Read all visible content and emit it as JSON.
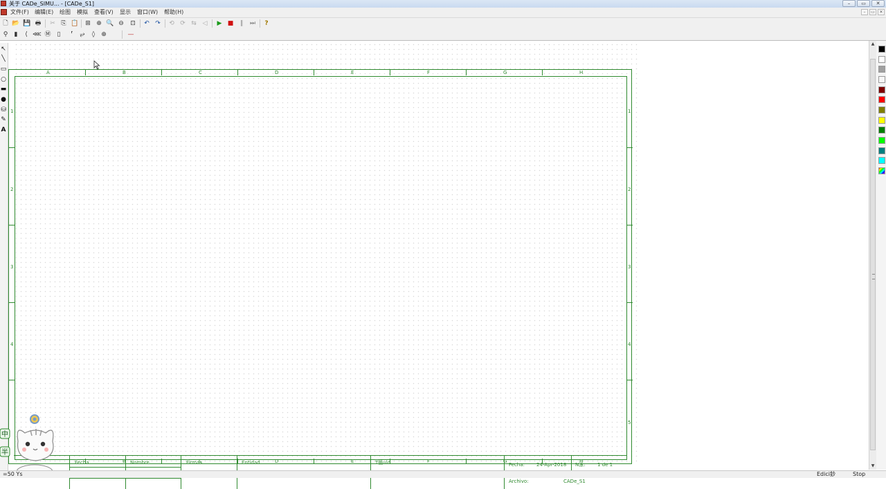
{
  "window": {
    "title": "关于 CADe_SIMU... - [CADe_S1]",
    "controls": [
      "–",
      "▭",
      "✕"
    ]
  },
  "mdi_controls": [
    "–",
    "▭",
    "✕"
  ],
  "menu": [
    {
      "id": "file",
      "label": "文件(F)"
    },
    {
      "id": "edit",
      "label": "编辑(E)"
    },
    {
      "id": "draw",
      "label": "绘图"
    },
    {
      "id": "simulate",
      "label": "模拟"
    },
    {
      "id": "view",
      "label": "查看(V)"
    },
    {
      "id": "display",
      "label": "显示"
    },
    {
      "id": "window",
      "label": "窗口(W)"
    },
    {
      "id": "help",
      "label": "帮助(H)"
    }
  ],
  "toolbar1": [
    {
      "id": "new",
      "glyph": "🗋",
      "icon": "new-file-icon"
    },
    {
      "id": "open",
      "glyph": "📂",
      "icon": "open-folder-icon"
    },
    {
      "id": "save",
      "glyph": "💾",
      "icon": "save-icon"
    },
    {
      "id": "print",
      "glyph": "🖶",
      "icon": "print-icon"
    },
    {
      "id": "cut",
      "glyph": "✂",
      "icon": "cut-icon"
    },
    {
      "id": "copy",
      "glyph": "⎘",
      "icon": "copy-icon"
    },
    {
      "id": "paste",
      "glyph": "📋",
      "icon": "paste-icon"
    },
    {
      "id": "zoom-page",
      "glyph": "⊞",
      "icon": "zoom-page-icon"
    },
    {
      "id": "zoom-in",
      "glyph": "⊕",
      "icon": "zoom-in-icon"
    },
    {
      "id": "zoom",
      "glyph": "🔍",
      "icon": "zoom-icon"
    },
    {
      "id": "zoom-out",
      "glyph": "⊖",
      "icon": "zoom-out-icon"
    },
    {
      "id": "zoom-fit",
      "glyph": "⊡",
      "icon": "zoom-fit-icon"
    },
    {
      "id": "undo",
      "glyph": "↶",
      "icon": "undo-icon"
    },
    {
      "id": "redo",
      "glyph": "↷",
      "icon": "redo-icon"
    },
    {
      "id": "t1",
      "glyph": "⟲",
      "icon": "rotate-left-icon"
    },
    {
      "id": "t2",
      "glyph": "⟳",
      "icon": "rotate-right-icon"
    },
    {
      "id": "t3",
      "glyph": "⇆",
      "icon": "flip-icon"
    },
    {
      "id": "t4",
      "glyph": "◁",
      "icon": "mirror-icon"
    },
    {
      "id": "play",
      "glyph": "▶",
      "icon": "play-icon"
    },
    {
      "id": "stop",
      "glyph": "■",
      "icon": "stop-icon"
    },
    {
      "id": "pause",
      "glyph": "∥",
      "icon": "pause-icon"
    },
    {
      "id": "step",
      "glyph": "⏭",
      "icon": "step-icon"
    },
    {
      "id": "help",
      "glyph": "?",
      "icon": "help-icon"
    }
  ],
  "toolbar2": [
    {
      "id": "c1",
      "glyph": "⚲",
      "icon": "component-supply-icon"
    },
    {
      "id": "c2",
      "glyph": "▮",
      "icon": "component-fuse-icon"
    },
    {
      "id": "c3",
      "glyph": "⟨",
      "icon": "component-switch-icon"
    },
    {
      "id": "c4",
      "glyph": "⋘",
      "icon": "component-contactor-icon"
    },
    {
      "id": "c5",
      "glyph": "Ⓜ",
      "icon": "component-motor-icon"
    },
    {
      "id": "c6",
      "glyph": "▯",
      "icon": "component-relay-icon"
    },
    {
      "id": "c7",
      "glyph": "⸢",
      "icon": "component-contact-icon"
    },
    {
      "id": "c8",
      "glyph": "⥂",
      "icon": "component-pushbutton-icon"
    },
    {
      "id": "c9",
      "glyph": "◊",
      "icon": "component-sensor-icon"
    },
    {
      "id": "c10",
      "glyph": "⊕",
      "icon": "component-lamp-icon"
    },
    {
      "id": "c11",
      "glyph": "—",
      "icon": "wire-icon"
    }
  ],
  "left_tools": [
    {
      "id": "select",
      "glyph": "↖",
      "icon": "select-arrow-icon"
    },
    {
      "id": "line",
      "glyph": "╲",
      "icon": "line-icon"
    },
    {
      "id": "rect",
      "glyph": "▭",
      "icon": "rectangle-icon"
    },
    {
      "id": "circle",
      "glyph": "○",
      "icon": "circle-icon"
    },
    {
      "id": "filled-rect",
      "glyph": "▬",
      "icon": "filled-rectangle-icon"
    },
    {
      "id": "filled-ellipse",
      "glyph": "●",
      "icon": "filled-ellipse-icon"
    },
    {
      "id": "fill",
      "glyph": "⛁",
      "icon": "fill-bucket-icon"
    },
    {
      "id": "pen",
      "glyph": "✎",
      "icon": "pen-icon"
    },
    {
      "id": "text",
      "glyph": "A",
      "icon": "text-icon"
    }
  ],
  "sheet": {
    "columns": [
      "A",
      "B",
      "C",
      "D",
      "E",
      "F",
      "G",
      "H"
    ],
    "rows": [
      "1",
      "2",
      "3",
      "4",
      "5"
    ],
    "title_block": {
      "fecha": "Fecha",
      "nombre": "Nombre",
      "firmas": "Firmas",
      "entidad": "Entidad",
      "titulo": "T循ulo",
      "fecha_label": "Fecha:",
      "fecha_value": "24-Apr-2018",
      "num_label": "N泳:",
      "num_value": "1 de 1",
      "archivo_label": "Archivo:",
      "archivo_value": "CADe_S1"
    }
  },
  "palette": [
    "#000000",
    "#ffffff",
    "#a0a0a0",
    "#f6f6f6",
    "#800000",
    "#ff0000",
    "#808000",
    "#ffff00",
    "#008000",
    "#00ff00",
    "#008080",
    "#00ffff"
  ],
  "status": {
    "coords": "=50 Ys",
    "mode": "Edici鈔",
    "state": "Stop"
  }
}
